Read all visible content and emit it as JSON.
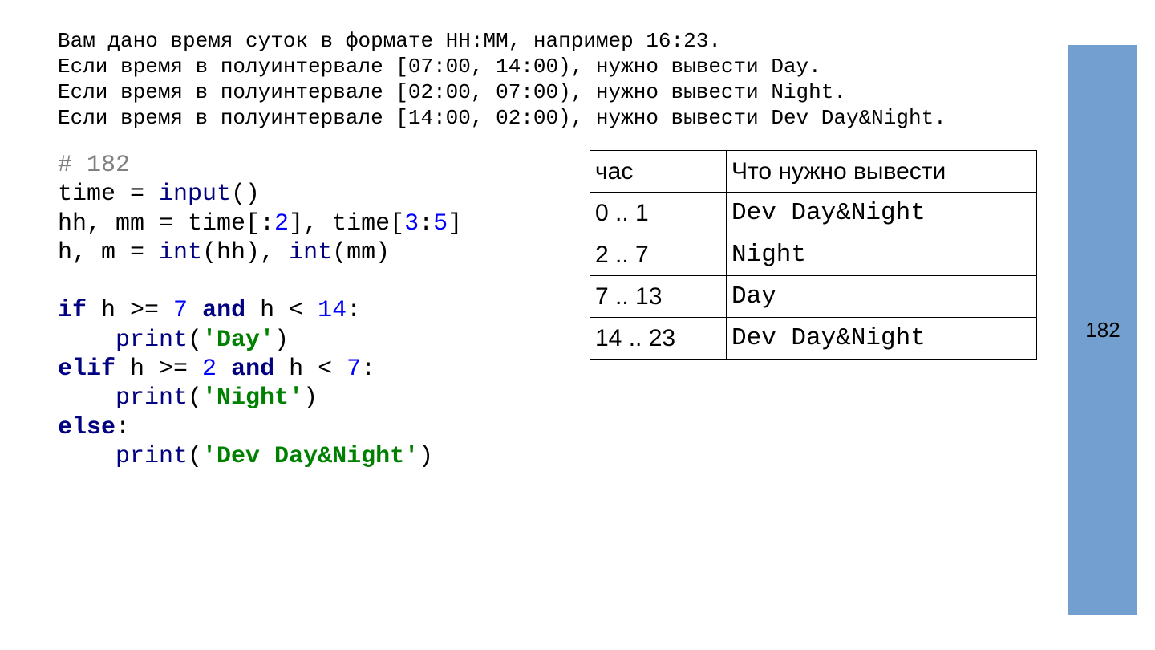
{
  "statement": [
    "Вам дано время суток в формате HH:MM, например 16:23.",
    "Если время в полуинтервале [07:00, 14:00), нужно вывести Day.",
    "Если время в полуинтервале [02:00, 07:00), нужно вывести Night.",
    "Если время в полуинтервале [14:00, 02:00), нужно вывести Dev Day&Night."
  ],
  "code": {
    "comment": "# 182",
    "line1": {
      "var": "time = ",
      "fn": "input",
      "rest": "()"
    },
    "line2": {
      "a": "hh, mm = time[:",
      "n1": "2",
      "b": "], time[",
      "n2": "3",
      "c": ":",
      "n3": "5",
      "d": "]"
    },
    "line3": {
      "a": "h, m = ",
      "fn1": "int",
      "b": "(hh), ",
      "fn2": "int",
      "c": "(mm)"
    },
    "if_line": {
      "kw": "if",
      "a": " h >= ",
      "n1": "7",
      "and": " and",
      "b": " h < ",
      "n2": "14",
      "c": ":"
    },
    "print_day": {
      "indent": "    ",
      "fn": "print",
      "open": "(",
      "str": "'Day'",
      "close": ")"
    },
    "elif_line": {
      "kw": "elif",
      "a": " h >= ",
      "n1": "2",
      "and": " and",
      "b": " h < ",
      "n2": "7",
      "c": ":"
    },
    "print_night": {
      "indent": "    ",
      "fn": "print",
      "open": "(",
      "str": "'Night'",
      "close": ")"
    },
    "else_line": {
      "kw": "else",
      "c": ":"
    },
    "print_dev": {
      "indent": "    ",
      "fn": "print",
      "open": "(",
      "str": "'Dev Day&Night'",
      "close": ")"
    }
  },
  "table": {
    "headers": [
      "час",
      "Что нужно вывести"
    ],
    "rows": [
      [
        "0 .. 1",
        "Dev Day&Night"
      ],
      [
        "2 .. 7",
        "Night"
      ],
      [
        "7 .. 13",
        "Day"
      ],
      [
        "14 .. 23",
        "Dev Day&Night"
      ]
    ]
  },
  "sidebar": {
    "label": "182",
    "color": "#729fcf"
  }
}
